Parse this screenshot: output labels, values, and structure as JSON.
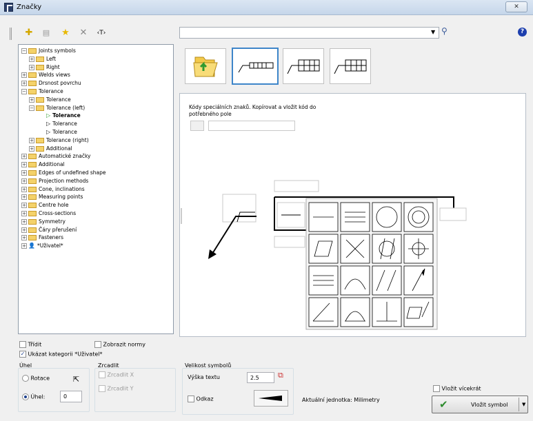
{
  "window": {
    "title": "Značky",
    "close_glyph": "✕"
  },
  "toolbar": {
    "items": [
      "add-icon",
      "properties-icon",
      "favorite-icon",
      "delete-icon",
      "text-icon"
    ],
    "text_glyph": "‹T›",
    "search_value": "",
    "help_glyph": "?"
  },
  "tree": {
    "items": [
      {
        "label": "Joints symbols",
        "level": 0,
        "exp": "−",
        "type": "folder"
      },
      {
        "label": "Left",
        "level": 1,
        "exp": "+",
        "type": "folder"
      },
      {
        "label": "Right",
        "level": 1,
        "exp": "+",
        "type": "folder"
      },
      {
        "label": "Welds views",
        "level": 0,
        "exp": "+",
        "type": "folder"
      },
      {
        "label": "Drsnost povrchu",
        "level": 0,
        "exp": "+",
        "type": "folder"
      },
      {
        "label": "Tolerance",
        "level": 0,
        "exp": "−",
        "type": "folder"
      },
      {
        "label": "Tolerance",
        "level": 1,
        "exp": "+",
        "type": "folder"
      },
      {
        "label": "Tolerance (left)",
        "level": 1,
        "exp": "−",
        "type": "folder"
      },
      {
        "label": "Tolerance",
        "level": 2,
        "exp": "",
        "type": "item-sel"
      },
      {
        "label": "Tolerance",
        "level": 2,
        "exp": "",
        "type": "item"
      },
      {
        "label": "Tolerance",
        "level": 2,
        "exp": "",
        "type": "item"
      },
      {
        "label": "Tolerance (right)",
        "level": 1,
        "exp": "+",
        "type": "folder"
      },
      {
        "label": "Additional",
        "level": 1,
        "exp": "+",
        "type": "folder"
      },
      {
        "label": "Automatické značky",
        "level": 0,
        "exp": "+",
        "type": "folder"
      },
      {
        "label": "Additional",
        "level": 0,
        "exp": "+",
        "type": "folder"
      },
      {
        "label": "Edges of undefined shape",
        "level": 0,
        "exp": "+",
        "type": "folder"
      },
      {
        "label": "Projection methods",
        "level": 0,
        "exp": "+",
        "type": "folder"
      },
      {
        "label": "Cone, inclinations",
        "level": 0,
        "exp": "+",
        "type": "folder"
      },
      {
        "label": "Measuring points",
        "level": 0,
        "exp": "+",
        "type": "folder"
      },
      {
        "label": "Centre hole",
        "level": 0,
        "exp": "+",
        "type": "folder"
      },
      {
        "label": "Cross-sections",
        "level": 0,
        "exp": "+",
        "type": "folder"
      },
      {
        "label": "Symmetry",
        "level": 0,
        "exp": "+",
        "type": "folder"
      },
      {
        "label": "Čáry přerušení",
        "level": 0,
        "exp": "+",
        "type": "folder"
      },
      {
        "label": "Fasteners",
        "level": 0,
        "exp": "+",
        "type": "folder"
      },
      {
        "label": "*Uživatel*",
        "level": 0,
        "exp": "+",
        "type": "user"
      }
    ]
  },
  "hint": {
    "text": "Kódy speciálních znaků. Kopírovat a vložit kód do potřebného pole",
    "code_value": ""
  },
  "options": {
    "sort_label": "Třídit",
    "show_norms_label": "Zobrazit normy",
    "show_user_label": "Ukázat kategorii *Uživatel*",
    "angle_group": "Úhel",
    "rotation_label": "Rotace",
    "angle_label": "Úhel:",
    "angle_value": "0",
    "mirror_group": "Zrcadlit",
    "mirror_x": "Zrcadlit X",
    "mirror_y": "Zrcadlit Y",
    "size_group": "Velikost symbolů",
    "text_height_label": "Výška textu",
    "text_height_value": "2.5",
    "leader_label": "Odkaz",
    "units_label": "Aktuální jednotka: Milimetry",
    "insert_multiple_label": "Vložit vícekrát",
    "insert_button": "Vložit symbol"
  }
}
